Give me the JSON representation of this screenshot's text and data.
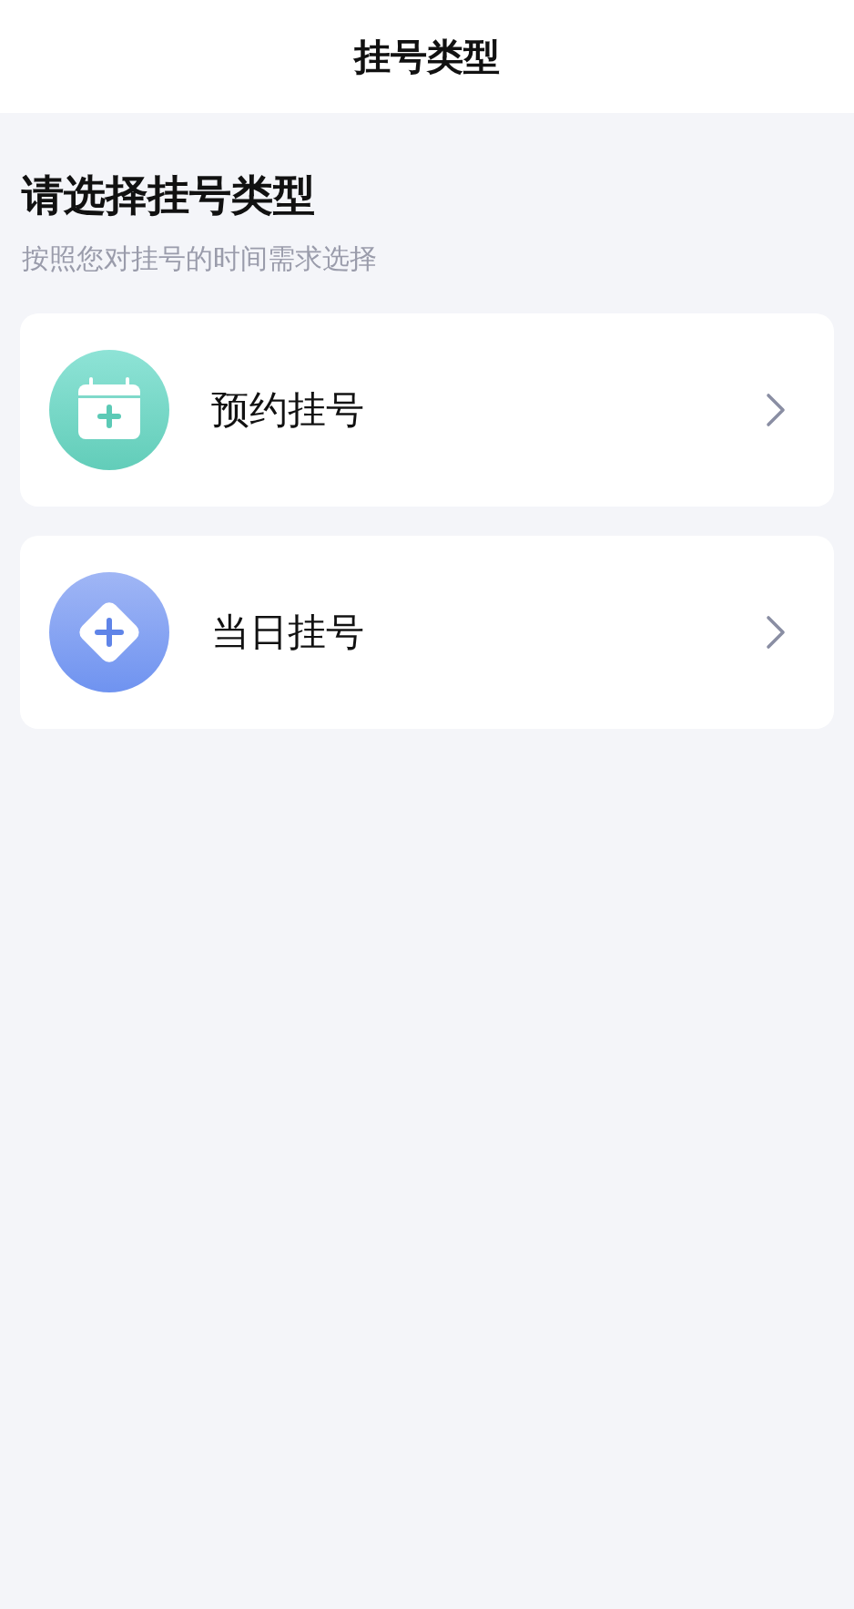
{
  "header": {
    "title": "挂号类型"
  },
  "heading": "请选择挂号类型",
  "subtitle": "按照您对挂号的时间需求选择",
  "options": [
    {
      "kind": "calendar",
      "label": "预约挂号"
    },
    {
      "kind": "diamond",
      "label": "当日挂号"
    }
  ]
}
